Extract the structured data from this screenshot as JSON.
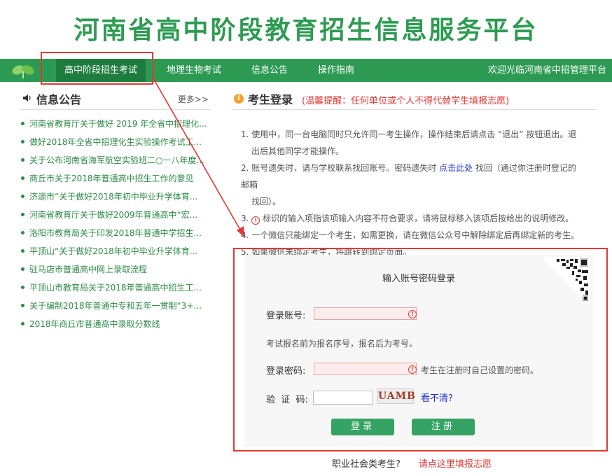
{
  "site_title": "河南省高中阶段教育招生信息服务平台",
  "nav": {
    "items": [
      "高中阶段招生考试",
      "地理生物考试",
      "信息公告",
      "操作指南"
    ],
    "welcome": "欢迎光临河南省中招管理平台"
  },
  "sidebar": {
    "title": "信息公告",
    "more": "更多>>",
    "news": [
      "河南省教育厅关于做好 2019 年全省中招理化...",
      "做好2018年全省中招理化生实验操作考试工...",
      "关于公布河南省海军航空实验班二○一八年度...",
      "商丘市关于2018年普通高中招生工作的意见",
      "济源市“关于做好2018年初中毕业升学体育...",
      "河南省教育厅关于做好2009年普通高中“宏...",
      "洛阳市教育局关于印发2018年普通中学招生...",
      "平顶山“关于做好2018年初中毕业升学体育...",
      "驻马店市普通高中网上录取流程",
      "平顶山市教育局关于2018年普通高中招生工...",
      "关于编制2018年普通中专和五年一贯制“3+...",
      "2018年商丘市普通高中录取分数线"
    ]
  },
  "main": {
    "title": "考生登录",
    "warning": "(温馨提醒：任何单位或个人不得代替学生填报志愿)",
    "notes": {
      "n1a": "1. 使用中，同一台电脑同时只允许同一考生操作，操作结束后请点击 “退出” 按钮退出。退",
      "n1b": "出后其他同学才能操作。",
      "n2a_pre": "2. 账号遗失时，请与学校联系找回账号。密码遗失时 ",
      "n2a_link": "点击此处",
      "n2a_post": " 找回（通过你注册时登记的邮箱",
      "n2b": "找回）。",
      "n3_num": "3.",
      "n3_icon": "!",
      "n3_text": " 标识的输入项指该项输入内容不符合要求，请将鼠标移入该项后按给出的说明修改。",
      "n4": "4. 一个微信只能绑定一个考生，如需更换，请在微信公众号中解除绑定后再绑定新的考生。",
      "n5": "5. 如果微信未绑定考生，将跳转到绑定页面。"
    }
  },
  "login": {
    "title": "输入账号密码登录",
    "account_label": "登录账号:",
    "account_value": "",
    "account_hint": "考试报名前为报名序号，报名后为考号。",
    "password_label": "登录密码:",
    "password_value": "",
    "password_hint": "考生在注册时自己设置的密码。",
    "captcha_label": "验  证  码:",
    "captcha_value": "",
    "captcha_text": "UAMB",
    "refresh_link": "看不清?",
    "error_icon": "!",
    "login_button": "登录",
    "register_button": "注册"
  },
  "footer": {
    "question": "职业社会类考生?",
    "link": "请点这里填报志愿"
  },
  "colors": {
    "brand_green": "#2e9b52",
    "nav_active": "#1e7d3e",
    "highlight_red": "#e03a35",
    "button_green": "#35a363",
    "link_blue": "#2233cc"
  }
}
